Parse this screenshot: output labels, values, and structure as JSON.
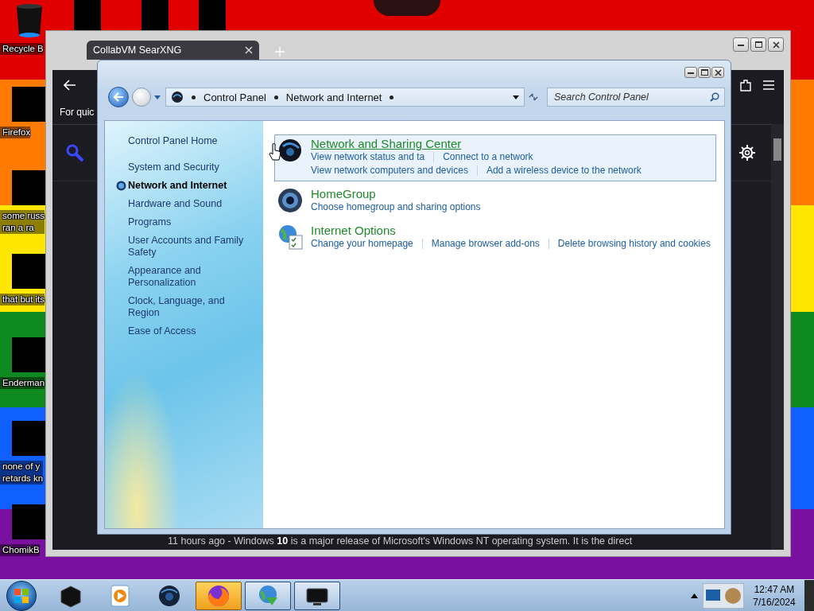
{
  "desktop": {
    "icons": [
      {
        "label": "Recycle B",
        "kind": "bin"
      },
      {
        "label": "Firefox",
        "kind": "blocked"
      },
      {
        "label": "some russ\nran a ra",
        "kind": "blocked"
      },
      {
        "label": "that but its",
        "kind": "blocked"
      },
      {
        "label": "Enderman",
        "kind": "blocked"
      },
      {
        "label": "none of y\nretards kn",
        "kind": "blocked"
      },
      {
        "label": "ChomikB",
        "kind": "blocked"
      }
    ]
  },
  "browser": {
    "tabs": [
      {
        "title": "CollabVM SearXNG",
        "selected": true
      }
    ],
    "hint": "For quic",
    "snippet": "11 hours ago - Windows **10** is a major release of Microsoft's Windows NT operating system. It is the direct"
  },
  "control_panel": {
    "breadcrumbs": [
      "Control Panel",
      "Network and Internet"
    ],
    "search": {
      "placeholder": "Search Control Panel"
    },
    "sidebar": {
      "items": [
        {
          "label": "Control Panel Home",
          "kind": "home",
          "selected": false
        },
        {
          "label": "System and Security",
          "kind": "category",
          "selected": false
        },
        {
          "label": "Network and Internet",
          "kind": "category",
          "selected": true
        },
        {
          "label": "Hardware and Sound",
          "kind": "category",
          "selected": false
        },
        {
          "label": "Programs",
          "kind": "category",
          "selected": false
        },
        {
          "label": "User Accounts and Family Safety",
          "kind": "category",
          "selected": false
        },
        {
          "label": "Appearance and Personalization",
          "kind": "category",
          "selected": false
        },
        {
          "label": "Clock, Language, and Region",
          "kind": "category",
          "selected": false
        },
        {
          "label": "Ease of Access",
          "kind": "category",
          "selected": false
        }
      ]
    },
    "categories": [
      {
        "title": "Network and Sharing Center",
        "kind": "network",
        "highlighted": true,
        "links": [
          [
            "View network status and ta",
            "Connect to a network"
          ],
          [
            "View network computers and devices",
            "Add a wireless device to the network"
          ]
        ]
      },
      {
        "title": "HomeGroup",
        "kind": "homegroup",
        "highlighted": false,
        "links": [
          [
            "Choose homegroup and sharing options"
          ]
        ]
      },
      {
        "title": "Internet Options",
        "kind": "internet",
        "highlighted": false,
        "links": [
          [
            "Change your homepage",
            "Manage browser add-ons",
            "Delete browsing history and cookies"
          ]
        ]
      }
    ]
  },
  "taskbar": {
    "buttons": [
      {
        "kind": "box",
        "active": false,
        "running": false
      },
      {
        "kind": "media",
        "active": false,
        "running": false
      },
      {
        "kind": "globe",
        "active": false,
        "running": false
      },
      {
        "kind": "browser",
        "active": true,
        "running": false
      },
      {
        "kind": "download",
        "active": false,
        "running": true
      },
      {
        "kind": "monitor",
        "active": false,
        "running": true
      }
    ],
    "clock": {
      "time": "12:47 AM",
      "date": "7/16/2024"
    }
  }
}
